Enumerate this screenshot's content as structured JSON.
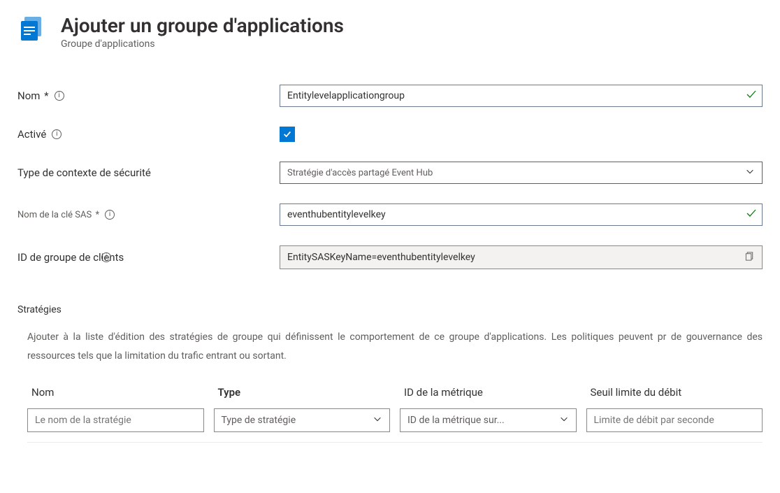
{
  "header": {
    "title": "Ajouter un groupe d'applications",
    "subtitle": "Groupe d'applications"
  },
  "form": {
    "name_label": "Nom",
    "name_value": "Entitylevelapplicationgroup",
    "enabled_label": "Activé",
    "security_context_label": "Type de contexte de sécurité",
    "security_context_value": "Stratégie d'accès partagé Event Hub",
    "sas_key_label": "Nom de la clé SAS",
    "sas_key_value": "eventhubentitylevelkey",
    "client_group_label": "ID de groupe de clients",
    "client_group_value": "EntitySASKeyName=eventhubentitylevelkey"
  },
  "strategies": {
    "title": "Stratégies",
    "description": "Ajouter à la liste d'édition des stratégies de groupe qui définissent le comportement de ce groupe d'applications. Les politiques peuvent pr de gouvernance des ressources tels que la limitation du trafic entrant ou sortant.",
    "columns": {
      "name": "Nom",
      "type": "Type",
      "metric_id": "ID de la métrique",
      "rate_limit": "Seuil limite du débit"
    },
    "placeholders": {
      "name": "Le nom de la stratégie",
      "type": "Type de stratégie",
      "metric_id": "ID de la métrique sur...",
      "rate_limit": "Limite de débit par seconde"
    }
  }
}
